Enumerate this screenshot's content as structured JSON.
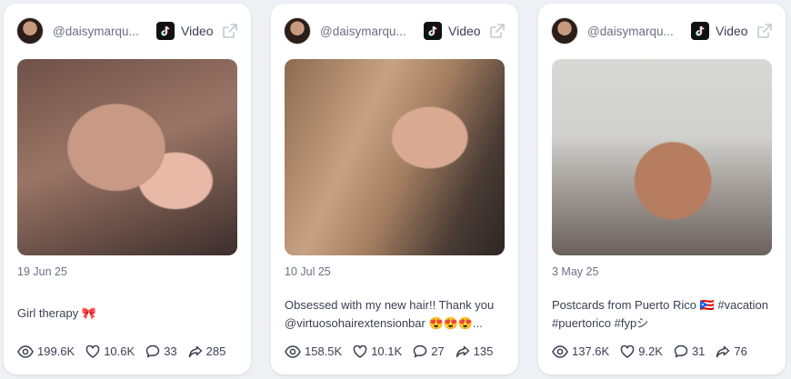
{
  "cards": [
    {
      "handle": "@daisymarqu...",
      "type_label": "Video",
      "date": "19 Jun 25",
      "caption": "Girl therapy 🎀",
      "views": "199.6K",
      "likes": "10.6K",
      "comments": "33",
      "shares": "285"
    },
    {
      "handle": "@daisymarqu...",
      "type_label": "Video",
      "date": "10 Jul 25",
      "caption": "Obsessed with my new hair!! Thank you @virtuosohairextensionbar 😍😍😍...",
      "views": "158.5K",
      "likes": "10.1K",
      "comments": "27",
      "shares": "135"
    },
    {
      "handle": "@daisymarqu...",
      "type_label": "Video",
      "date": "3 May 25",
      "caption": "Postcards from Puerto Rico 🇵🇷 #vacation #puertorico #fypシ",
      "views": "137.6K",
      "likes": "9.2K",
      "comments": "31",
      "shares": "76"
    }
  ]
}
